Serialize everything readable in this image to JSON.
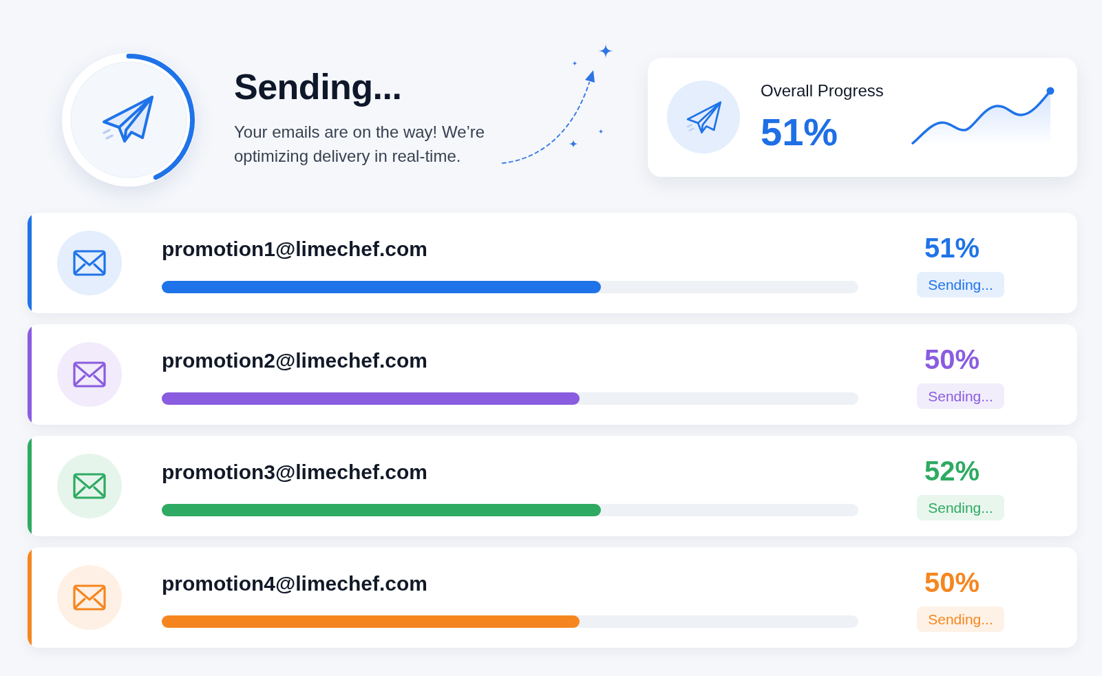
{
  "hero": {
    "title": "Sending...",
    "subtitle": "Your emails are on the way! We’re optimizing delivery in real-time.",
    "level": 0.43
  },
  "overall": {
    "label": "Overall Progress",
    "value": "51%"
  },
  "rows": [
    {
      "email": "promotion1@limechef.com",
      "level": 0.63,
      "percent": "51%",
      "status": "Sending...",
      "color": "#1f73e8"
    },
    {
      "email": "promotion2@limechef.com",
      "level": 0.6,
      "percent": "50%",
      "status": "Sending...",
      "color": "#8a5cdf"
    },
    {
      "email": "promotion3@limechef.com",
      "level": 0.63,
      "percent": "52%",
      "status": "Sending...",
      "color": "#2eaa62"
    },
    {
      "email": "promotion4@limechef.com",
      "level": 0.6,
      "percent": "50%",
      "status": "Sending...",
      "color": "#f5861f"
    }
  ]
}
